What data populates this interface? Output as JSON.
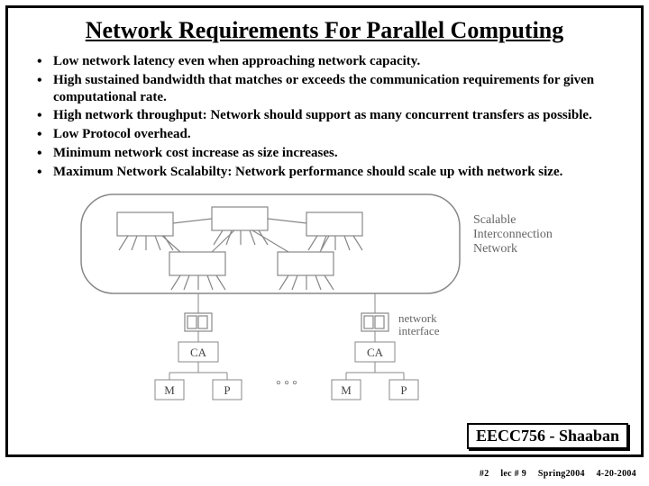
{
  "title": "Network Requirements For Parallel Computing",
  "bullets": [
    "Low network latency even when approaching network capacity.",
    "High sustained bandwidth that matches or exceeds the communication requirements for given computational rate.",
    "High network throughput:  Network should  support as many concurrent transfers as  possible.",
    "Low Protocol overhead.",
    "Minimum network cost increase as size increases.",
    "Maximum Network Scalabilty:  Network performance should scale up with network size."
  ],
  "diagram": {
    "cloud_label_1": "Scalable",
    "cloud_label_2": "Interconnection",
    "cloud_label_3": "Network",
    "iface_label": "network",
    "iface_label2": "interface",
    "ca": "CA",
    "m": "M",
    "p": "P",
    "ellipsis": "° ° °"
  },
  "course": "EECC756 - Shaaban",
  "footer": {
    "slide": "#2",
    "lec": "lec # 9",
    "term": "Spring2004",
    "date": "4-20-2004"
  }
}
